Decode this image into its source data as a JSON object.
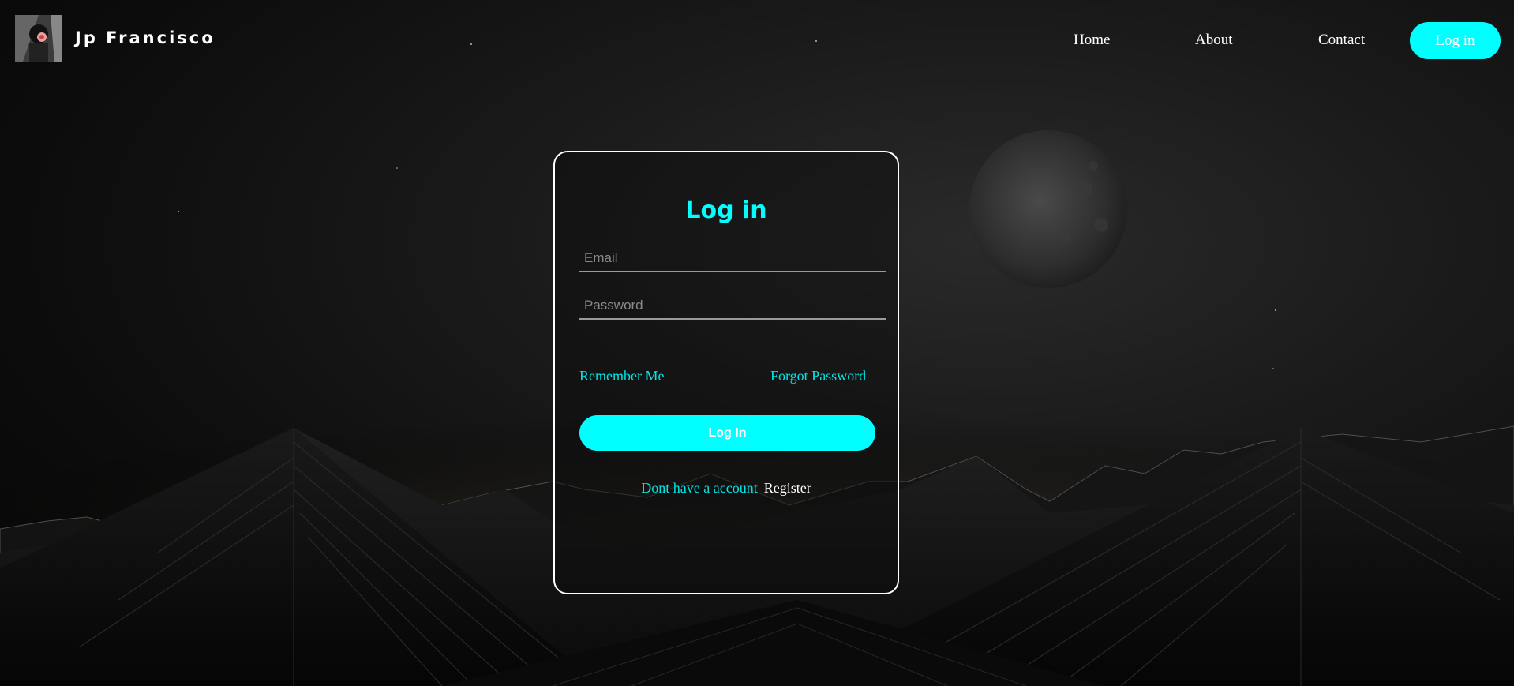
{
  "header": {
    "brand": "Jp Francisco",
    "nav": {
      "home": "Home",
      "about": "About",
      "contact": "Contact",
      "login": "Log in"
    }
  },
  "login_form": {
    "title": "Log in",
    "email": {
      "placeholder": "Email",
      "value": ""
    },
    "password": {
      "placeholder": "Password",
      "value": ""
    },
    "remember_label": "Remember Me",
    "forgot_label": "Forgot Password",
    "submit_label": "Log In",
    "no_account_text": "Dont have a account",
    "register_label": "Register"
  },
  "colors": {
    "accent": "#00ffff",
    "text": "#ffffff",
    "background": "#0c0c0c"
  }
}
